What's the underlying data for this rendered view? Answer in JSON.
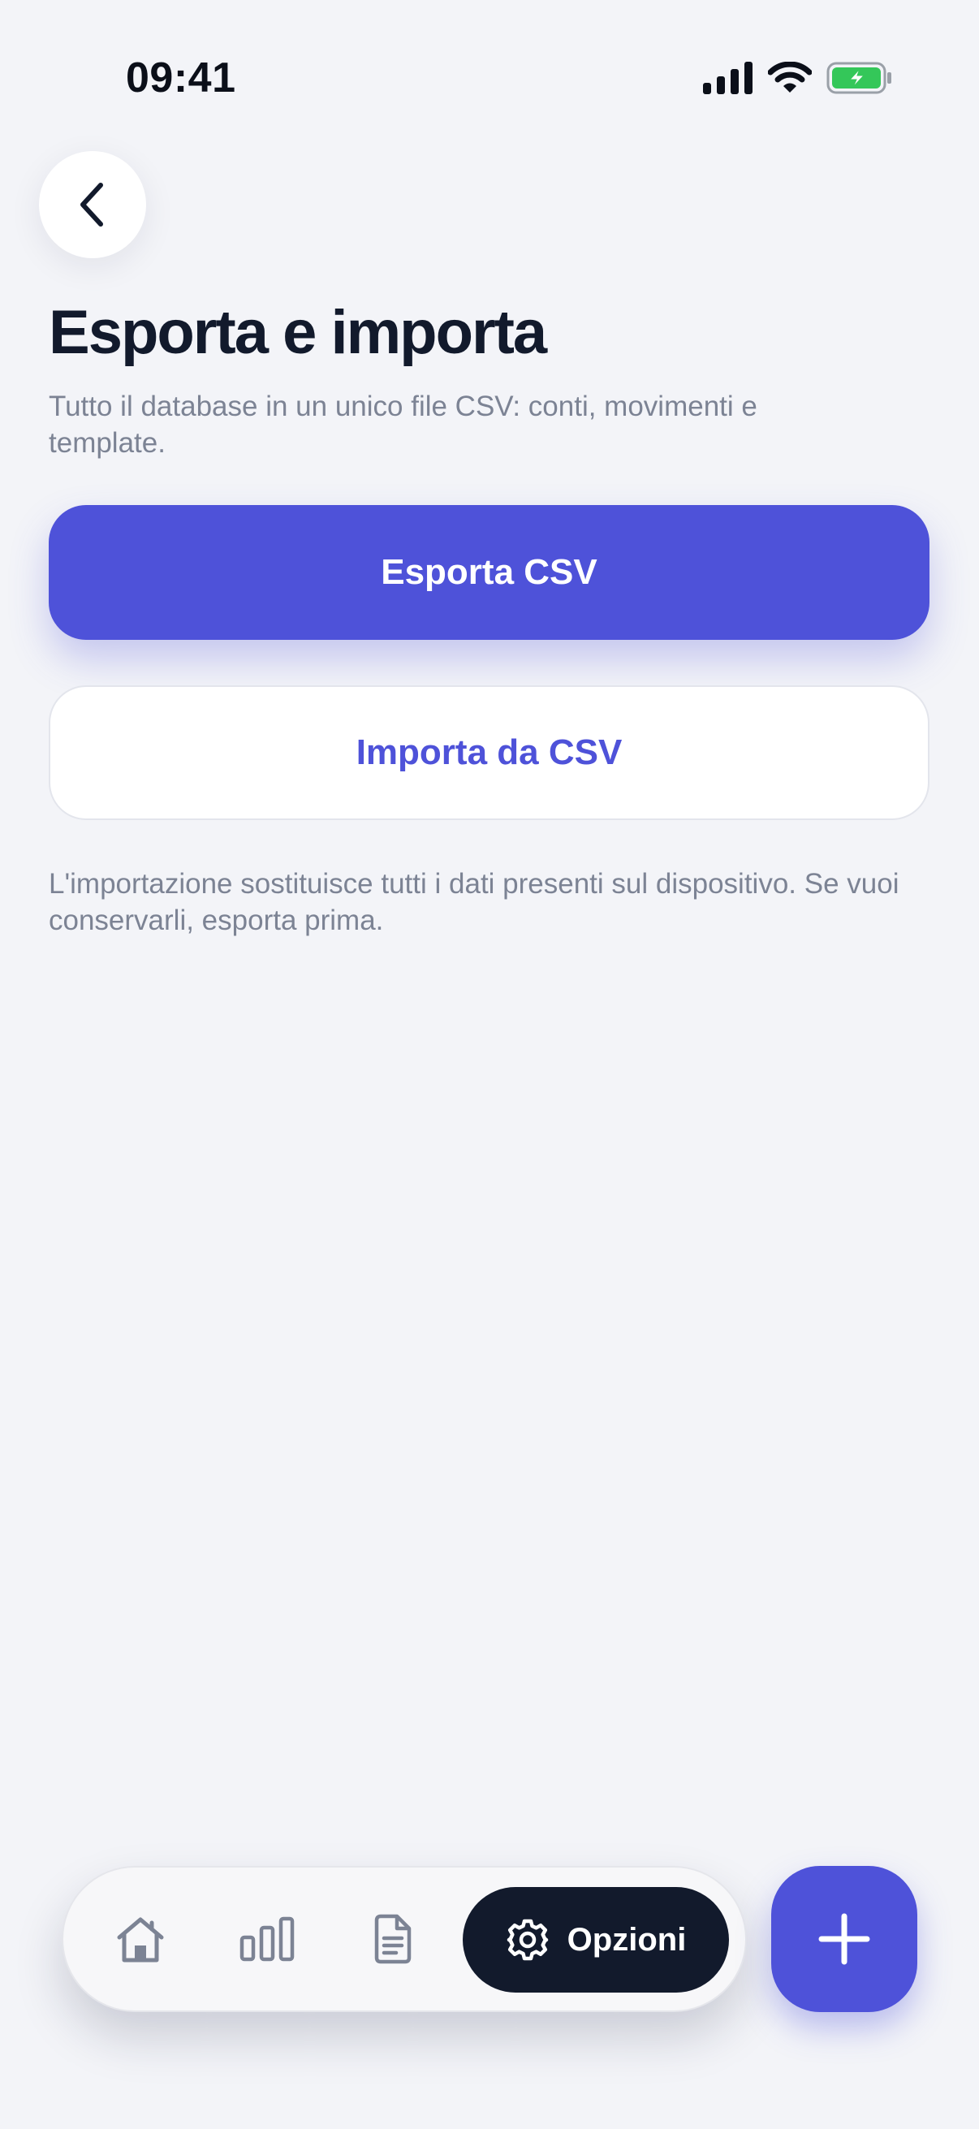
{
  "status_bar": {
    "time": "09:41",
    "icons": [
      "signal-icon",
      "wifi-icon",
      "battery-charging-icon"
    ],
    "battery_color": "#34c759"
  },
  "header": {
    "back_icon": "chevron-left-icon",
    "title": "Esporta e importa",
    "subtitle": "Tutto il database in un unico file CSV: conti, movimenti e template."
  },
  "actions": {
    "export_label": "Esporta CSV",
    "import_label": "Importa da CSV"
  },
  "note": "L'importazione sostituisce tutti i dati presenti sul dispositivo. Se vuoi conservarli, esporta prima.",
  "tabbar": {
    "tabs": [
      {
        "icon": "home-icon"
      },
      {
        "icon": "bar-chart-icon"
      },
      {
        "icon": "document-icon"
      },
      {
        "icon": "gear-icon",
        "label": "Opzioni",
        "active": true
      }
    ],
    "fab_icon": "plus-icon"
  },
  "colors": {
    "accent": "#4e52d9",
    "dark": "#121a2c",
    "background": "#f3f4f8",
    "muted_text": "#7c8394"
  }
}
